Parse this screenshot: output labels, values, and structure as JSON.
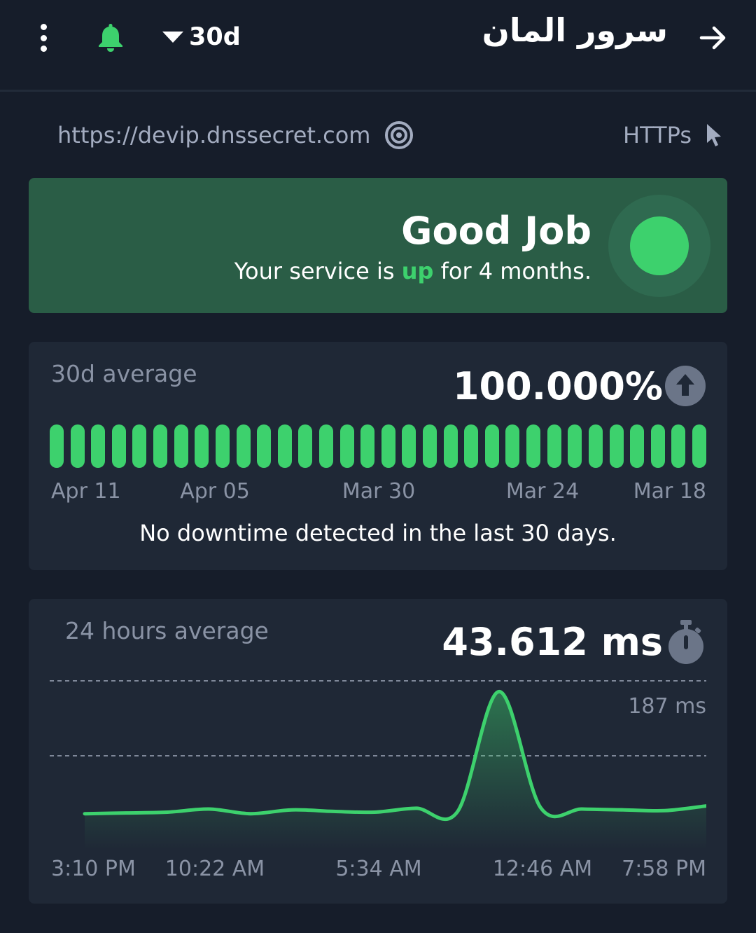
{
  "header": {
    "menu_icon": "more-vertical-icon",
    "bell_icon": "bell-icon",
    "range_label": "30d",
    "server_name": "سرور المان",
    "arrow_icon": "arrow-right-icon"
  },
  "monitor": {
    "url": "https://devip.dnssecret.com",
    "protocol": "HTTPs"
  },
  "status": {
    "title": "Good Job",
    "subtitle_prefix": "Your service is ",
    "subtitle_state": "up",
    "subtitle_suffix": " for 4 months.",
    "color_ok": "#3dd16d"
  },
  "uptime": {
    "label": "30d average",
    "value": "100.000%",
    "day_labels": [
      "Apr 11",
      "Apr 05",
      "Mar 30",
      "Mar 24",
      "Mar 18"
    ],
    "bar_count": 32,
    "message": "No downtime detected in the last 30 days."
  },
  "latency": {
    "label": "24 hours average",
    "value": "43.612 ms",
    "peak_label": "187 ms",
    "time_labels": [
      "3:10 PM",
      "10:22 AM",
      "5:34 AM",
      "12:46 AM",
      "7:58 PM"
    ]
  },
  "chart_data": {
    "type": "area",
    "title": "",
    "xlabel": "",
    "ylabel": "",
    "x": [
      "3:10 PM",
      "",
      "10:22 AM",
      "",
      "5:34 AM",
      "",
      "12:46 AM",
      "",
      "7:58 PM"
    ],
    "y_unit": "ms",
    "ylim": [
      0,
      200
    ],
    "series": [
      {
        "values": [
          30,
          31,
          32,
          36,
          30,
          35,
          33,
          32,
          37,
          33,
          187,
          38,
          36,
          35,
          34,
          40
        ]
      }
    ]
  }
}
